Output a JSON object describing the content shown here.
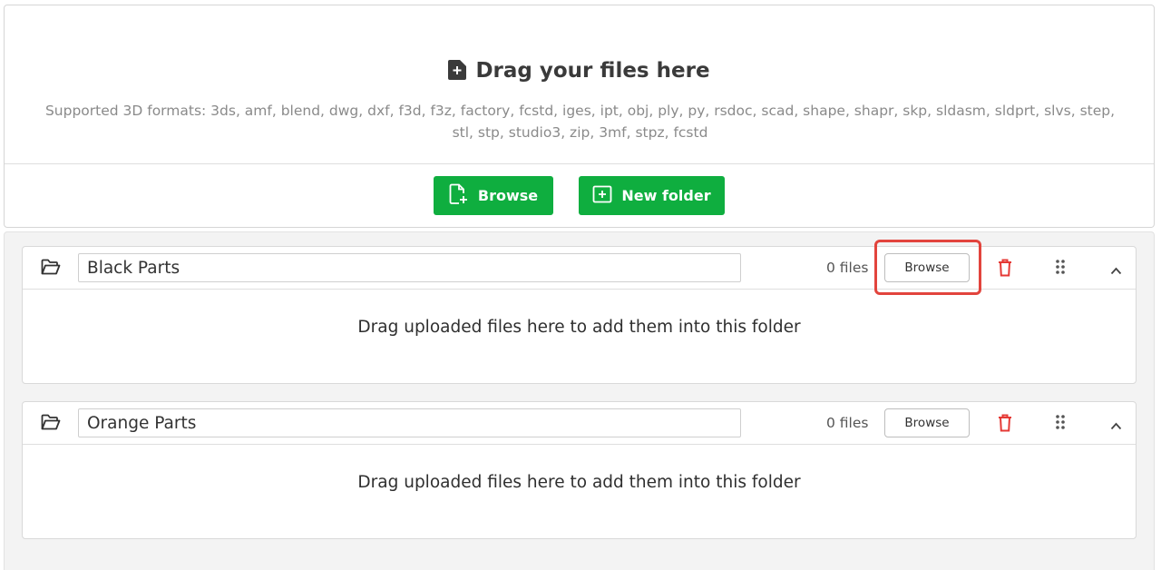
{
  "uploader": {
    "title": "Drag your files here",
    "formats_text": "Supported 3D formats: 3ds, amf, blend, dwg, dxf, f3d, f3z, factory, fcstd, iges, ipt, obj, ply, py, rsdoc, scad, shape, shapr, skp, sldasm, sldprt, slvs, step, stl, stp, studio3, zip, 3mf, stpz, fcstd",
    "browse_label": "Browse",
    "new_folder_label": "New folder"
  },
  "folders": [
    {
      "name": "Black Parts",
      "file_count": "0 files",
      "browse_label": "Browse",
      "hint": "Drag uploaded files here to add them into this folder"
    },
    {
      "name": "Orange Parts",
      "file_count": "0 files",
      "browse_label": "Browse",
      "hint": "Drag uploaded files here to add them into this folder"
    }
  ],
  "colors": {
    "accent_green": "#0fae3f",
    "delete_red": "#e53935",
    "highlight_red": "#e2443d"
  },
  "icons": {
    "title_icon": "file-plus-icon",
    "browse_icon": "file-add-icon",
    "new_folder_icon": "folder-plus-icon",
    "folder_icon": "folder-open-icon",
    "delete_icon": "trash-icon",
    "drag_icon": "drag-handle-icon",
    "collapse_icon": "chevron-up-icon"
  }
}
